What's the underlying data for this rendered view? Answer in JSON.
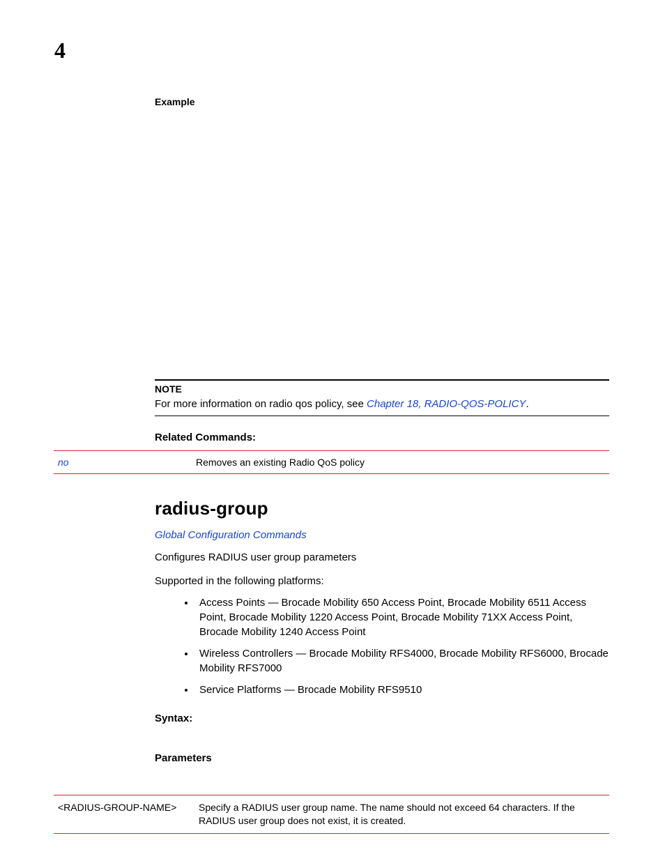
{
  "chapter_number": "4",
  "example_label": "Example",
  "note": {
    "label": "NOTE",
    "text_pre": "For more information on radio qos policy, see ",
    "link_text": "Chapter 18, RADIO-QOS-POLICY",
    "text_post": "."
  },
  "related_commands": {
    "heading": "Related Commands:",
    "rows": [
      {
        "cmd": "no",
        "desc": "Removes an existing Radio QoS policy"
      }
    ]
  },
  "section": {
    "title": "radius-group",
    "sublink": "Global Configuration Commands",
    "desc": "Configures RADIUS user group parameters",
    "supported_intro": "Supported in the following platforms:",
    "platforms": [
      "Access Points — Brocade Mobility 650 Access Point, Brocade Mobility 6511 Access Point, Brocade Mobility 1220 Access Point, Brocade Mobility 71XX Access Point, Brocade Mobility 1240 Access Point",
      "Wireless Controllers — Brocade Mobility RFS4000, Brocade Mobility RFS6000, Brocade Mobility RFS7000",
      "Service Platforms — Brocade Mobility RFS9510"
    ],
    "syntax_label": "Syntax:",
    "parameters_label": "Parameters",
    "parameters": [
      {
        "name": "<RADIUS-GROUP-NAME>",
        "desc": "Specify a RADIUS user group name. The name should not exceed 64 characters. If the RADIUS user group does not exist, it is created."
      }
    ]
  }
}
